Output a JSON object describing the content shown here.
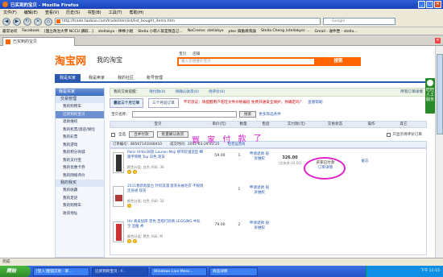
{
  "window": {
    "title": "已买到的宝贝 - Mozilla Firefox"
  },
  "menu": [
    "文件(F)",
    "编辑(E)",
    "查看(V)",
    "历史(S)",
    "书签(B)",
    "工具(T)",
    "帮助(H)"
  ],
  "nav": {
    "url": "http://trade.taobao.com/trade/itemlist/list_bought_items.htm",
    "search_placeholder": "Google"
  },
  "bookmarks": [
    "最常访问",
    "Facebook",
    "[国立政治大學 NCCU 讀取...]",
    "stellakyo - 棒棒小組",
    "Stella 小萌人就是我自己...",
    "NoCreme: stellakyo",
    "ptec 興動教育論",
    "Stella Cheng (stellakyo) ...",
    "Gmail - 收件匣 - stella..."
  ],
  "tab": {
    "label": "已买到的宝贝"
  },
  "taobao": {
    "logo": "淘宝网",
    "logo_sub": "我的淘宝",
    "search_tabs": [
      "宝贝",
      "店铺"
    ],
    "search_placeholder": "输入您想要的宝贝",
    "search_button": "搜索",
    "nav": [
      "我是买家",
      "我是卖家",
      "我的社区",
      "账号管理"
    ]
  },
  "sidebar": {
    "head": "我是买家",
    "groups": [
      {
        "title": "交易管理",
        "items": [
          "我的购物车",
          "已买到的宝贝",
          "退款维权",
          "我的机票/酒店/保险",
          "我的彩票",
          "我的游戏",
          "我的积分商城",
          "我的支付宝",
          "我的优惠卡券",
          "我的网络评价"
        ]
      },
      {
        "title": "我的我买",
        "items": [
          "我的收藏",
          "我的足迹",
          "我的购物车",
          "收货地址"
        ]
      }
    ],
    "active_item": "已买到的宝贝"
  },
  "main": {
    "summary": [
      "我的交易提醒：",
      "待付款(0)",
      "待确认收货(0)",
      "待评价(0)"
    ],
    "summary_right": "所有订单详情",
    "order_tabs": [
      "最近三个月订单",
      "三个月前订单"
    ],
    "warning": "不可思议：请提醒用户旺旺文件价格偏低 免费开通安全保护，你确定吗？",
    "check_link": "查看帮助",
    "filter_label": "宝贝名称：",
    "search_button": "搜索",
    "more_filter": "更多筛选条件",
    "columns": [
      "宝贝",
      "单价(元)",
      "数量",
      "售后",
      "实付款(元)",
      "交易状态",
      "操作",
      "其它"
    ],
    "status_select": "交易状态",
    "actions": [
      "全选",
      "合并付款",
      "批量确认收货"
    ],
    "only_unrated": "只显示待评价订单",
    "order": {
      "number_label": "订单编号：80567141048410",
      "date_label": "成交时间：2011-03-29 03:25",
      "seller": "经营运营商",
      "items": [
        {
          "title": "Paris Hilton同款 Lauren Moji 绑带软铺造型 细跟半筒靴 Top 白色 现货",
          "meta": "颜色分类: 白色 尺码: 36",
          "price": "59.00",
          "qty": "1",
          "refund": "申请退款 投诉维权"
        },
        {
          "title": "2011春新款复古 针织浪漫 套装长袖毛衣 不规则连身裙 现货",
          "meta": "颜色分类: 红色 尺码: 32",
          "price": "",
          "qty": "1",
          "refund": "申请退款 投诉维权"
        },
        {
          "title": "HH 真皮加厚 黑色 百搭打底裤 LEGGING 中长 全 显瘦 秀",
          "meta": "颜色分类: 黑色 尺码: M",
          "price": "79.00",
          "qty": "2",
          "refund": "申请退款 投诉维权"
        }
      ],
      "total": "326.00",
      "total_note": "(含快递:30.00)",
      "status": "买家已付款",
      "status_link": "订单详情",
      "op": "备忘"
    },
    "annotation": "買 家 付 款 了"
  },
  "float_help": "旺旺 人工服务",
  "statusbar": "完成",
  "taskbar": {
    "start": "開始",
    "tasks": [
      "[登入]壹錢交易 - 即...",
      "已买到的宝贝 - F...",
      "Windows Live Mess...",
      "商品详情"
    ],
    "tray": "下午 11:15"
  }
}
